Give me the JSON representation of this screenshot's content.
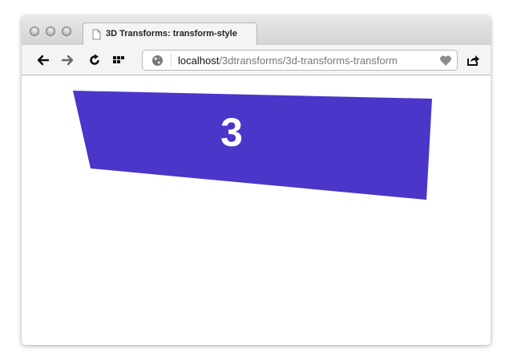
{
  "window": {
    "tab_title": "3D Transforms: transform-style"
  },
  "toolbar": {
    "back_icon": "back-arrow-icon",
    "forward_icon": "forward-arrow-icon",
    "reload_icon": "reload-icon",
    "grid_icon": "top-sites-grid-icon",
    "share_icon": "share-icon"
  },
  "address_bar": {
    "host": "localhost",
    "path": "/3dtransforms/3d-transforms-transform"
  },
  "content": {
    "panel_label": "3",
    "panel_color": "#4a36c9"
  }
}
